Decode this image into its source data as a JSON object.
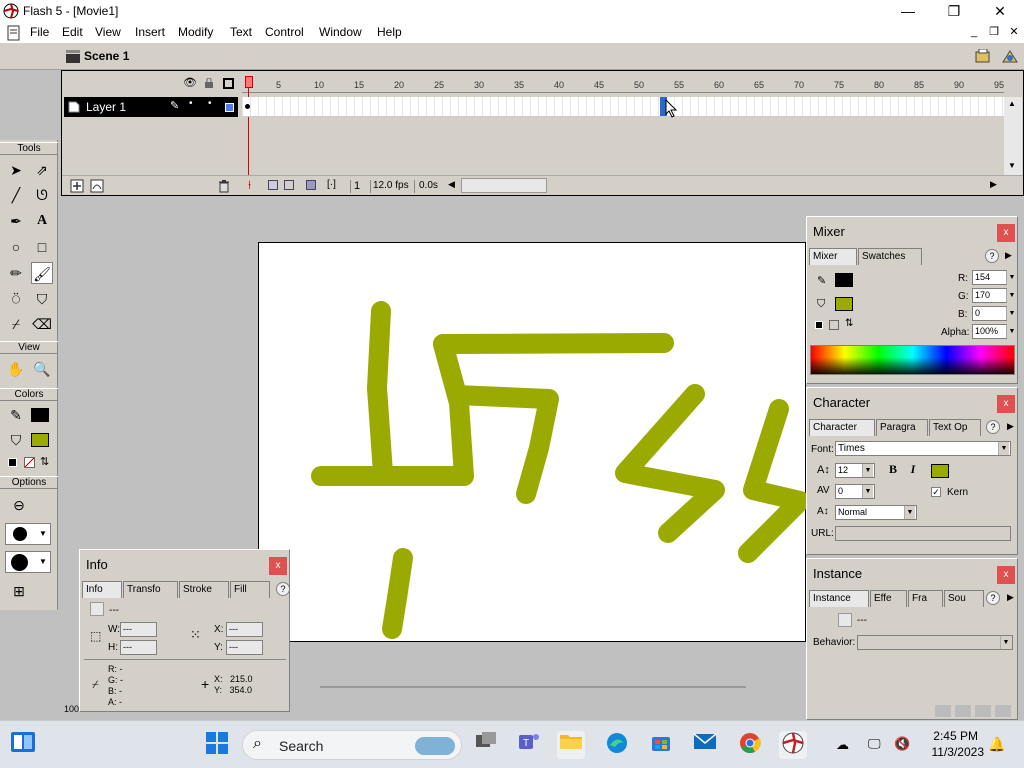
{
  "window": {
    "title": "Flash 5 - [Movie1]",
    "controls": [
      "minimize-icon",
      "maximize-icon",
      "close-icon"
    ]
  },
  "menu": [
    "File",
    "Edit",
    "View",
    "Insert",
    "Modify",
    "Text",
    "Control",
    "Window",
    "Help"
  ],
  "scene": {
    "label": "Scene 1"
  },
  "timeline": {
    "ticks": [
      "5",
      "10",
      "15",
      "20",
      "25",
      "30",
      "35",
      "40",
      "45",
      "50",
      "55",
      "60",
      "65",
      "70",
      "75",
      "80",
      "85",
      "90",
      "95"
    ],
    "layer_name": "Layer 1",
    "current_frame": "1",
    "frame_rate": "12.0 fps",
    "elapsed": "0.0s"
  },
  "tools": {
    "header": "Tools",
    "view_header": "View",
    "colors_header": "Colors",
    "options_header": "Options",
    "stroke_color": "#000000",
    "fill_color": "#9aaa00"
  },
  "stage": {
    "stroke_color": "#9aaa00"
  },
  "mixer": {
    "title": "Mixer",
    "tabs": [
      "Mixer",
      "Swatches"
    ],
    "r_label": "R:",
    "r": "154",
    "g_label": "G:",
    "g": "170",
    "b_label": "B:",
    "b": "0",
    "alpha_label": "Alpha:",
    "alpha": "100%",
    "fill_color": "#9aaa00"
  },
  "character": {
    "title": "Character",
    "tabs": [
      "Character",
      "Paragra",
      "Text Op"
    ],
    "font_label": "Font:",
    "font": "Times",
    "size": "12",
    "tracking": "0",
    "baseline": "Normal",
    "kern_label": "Kern",
    "url_label": "URL:",
    "bold": "B",
    "italic": "I",
    "text_color": "#9aaa00"
  },
  "instance": {
    "title": "Instance",
    "tabs": [
      "Instance",
      "Effe",
      "Fra",
      "Sou"
    ],
    "name": "---",
    "behavior_label": "Behavior:"
  },
  "info": {
    "title": "Info",
    "tabs": [
      "Info",
      "Transfo",
      "Stroke",
      "Fill"
    ],
    "name": "---",
    "w_label": "W:",
    "w": "---",
    "h_label": "H:",
    "h": "---",
    "x_label": "X:",
    "x": "---",
    "y_label": "Y:",
    "y": "---",
    "r": "R: -",
    "g": "G: -",
    "b": "B: -",
    "a": "A: -",
    "cursor_x": "X:   215.0",
    "cursor_y": "Y:   354.0"
  },
  "zoom": "100%",
  "taskbar": {
    "search_placeholder": "Search",
    "time": "2:45 PM",
    "date": "11/3/2023"
  }
}
